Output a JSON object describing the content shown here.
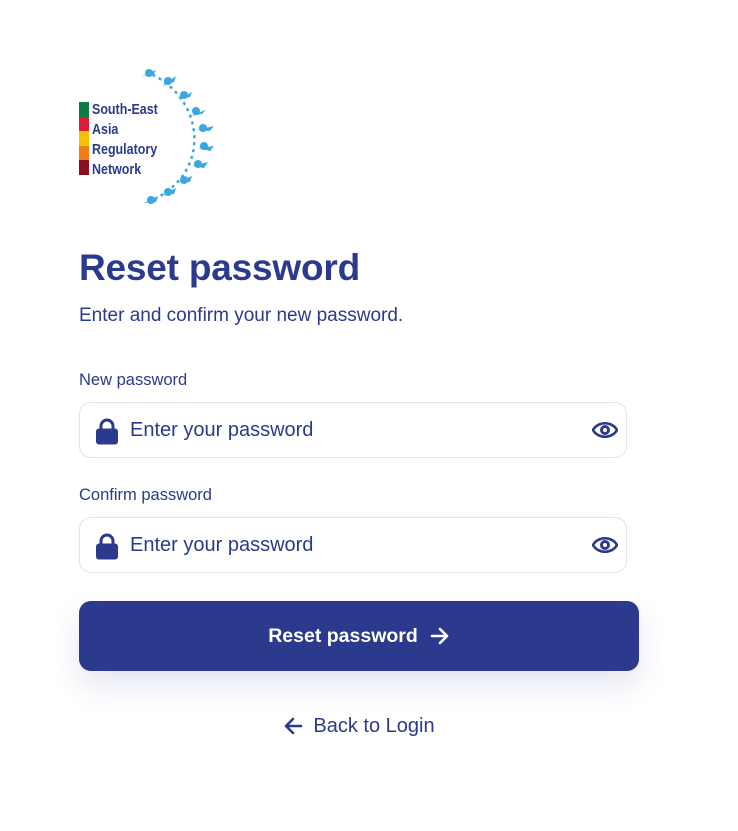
{
  "logo": {
    "lines": [
      "South-East",
      "Asia",
      "Regulatory",
      "Network"
    ],
    "bar_colors": [
      "#0e7a46",
      "#e01b3a",
      "#f3c300",
      "#f07d13",
      "#8c0f20"
    ],
    "arc_color": "#3aa7e0",
    "icon": "network-people-arc-icon"
  },
  "page": {
    "title": "Reset password",
    "subtitle": "Enter and confirm your new password."
  },
  "form": {
    "new_password": {
      "label": "New password",
      "placeholder": "Enter your password",
      "value": "",
      "icons": [
        "lock-icon",
        "eye-icon"
      ]
    },
    "confirm_password": {
      "label": "Confirm password",
      "placeholder": "Enter your password",
      "value": "",
      "icons": [
        "lock-icon",
        "eye-icon"
      ]
    },
    "submit_label": "Reset password",
    "submit_icon": "arrow-right-icon"
  },
  "back_link": {
    "label": "Back to Login",
    "icon": "arrow-left-icon"
  },
  "colors": {
    "primary": "#2b3a8c",
    "field_border": "#e2e4ea",
    "background": "#ffffff"
  }
}
